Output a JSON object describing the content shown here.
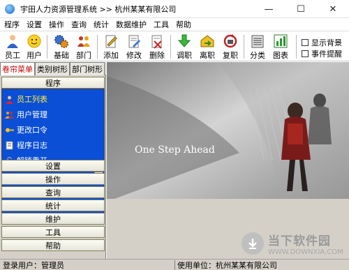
{
  "window": {
    "title": "宇田人力资源管理系统 >> 杭州某某有限公司",
    "minimize_glyph": "—",
    "maximize_glyph": "☐",
    "close_glyph": "✕"
  },
  "menubar": {
    "items": [
      "程序",
      "设置",
      "操作",
      "查询",
      "统计",
      "数据维护",
      "工具",
      "帮助"
    ]
  },
  "toolbar": {
    "buttons": [
      {
        "label": "员工",
        "icon": "employee-icon"
      },
      {
        "label": "用户",
        "icon": "user-smiley-icon"
      },
      {
        "label": "基础",
        "icon": "gears-icon"
      },
      {
        "label": "部门",
        "icon": "department-icon"
      },
      {
        "label": "添加",
        "icon": "add-pencil-icon"
      },
      {
        "label": "修改",
        "icon": "edit-icon"
      },
      {
        "label": "删除",
        "icon": "delete-icon"
      },
      {
        "label": "调职",
        "icon": "transfer-arrow-icon"
      },
      {
        "label": "离职",
        "icon": "resign-icon"
      },
      {
        "label": "复职",
        "icon": "reinstate-icon"
      },
      {
        "label": "分类",
        "icon": "classify-icon"
      },
      {
        "label": "图表",
        "icon": "chart-icon"
      }
    ],
    "checkboxes": [
      {
        "label": "显示背景",
        "checked": false
      },
      {
        "label": "事件提醒",
        "checked": false
      }
    ]
  },
  "leftpanel": {
    "tabs": [
      {
        "label": "卷帘菜单",
        "active": true
      },
      {
        "label": "类别树形",
        "active": false
      },
      {
        "label": "部门树形",
        "active": false
      }
    ],
    "top_group": "程序",
    "list_items": [
      {
        "label": "员工列表",
        "icon": "employee-list-icon",
        "selected": true
      },
      {
        "label": "用户管理",
        "icon": "user-manage-icon",
        "selected": false
      },
      {
        "label": "更改口令",
        "icon": "password-icon",
        "selected": false
      },
      {
        "label": "程序日志",
        "icon": "log-icon",
        "selected": false
      },
      {
        "label": "解锁重开",
        "icon": "unlock-icon",
        "selected": false
      }
    ],
    "bottom_groups": [
      "设置",
      "操作",
      "查询",
      "统计",
      "维护",
      "工具",
      "帮助"
    ]
  },
  "hero": {
    "caption": "One Step Ahead"
  },
  "statusbar": {
    "login_user": "登录用户：管理员",
    "unit": "使用单位：杭州某某有限公司"
  },
  "watermark": {
    "title": "当下软件园",
    "subtitle": "WWW.DOWNXIA.COM"
  }
}
